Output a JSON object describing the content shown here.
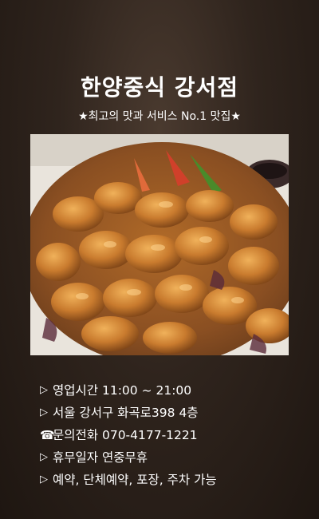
{
  "header": {
    "title": "한양중식 강서점",
    "subtitle": "★최고의 맛과 서비스 No.1 맛집★"
  },
  "photo": {
    "subject": "fried-pork-dish-photo"
  },
  "info": {
    "hours": {
      "marker": "▷",
      "text": "영업시간 11:00 ~ 21:00"
    },
    "address": {
      "marker": "▷",
      "text": "서울 강서구 화곡로398 4층"
    },
    "phone": {
      "marker": "☎",
      "text": "문의전화 070-4177-1221"
    },
    "holiday": {
      "marker": "▷",
      "text": "휴무일자 연중무휴"
    },
    "services": {
      "marker": "▷",
      "text": "예약, 단체예약, 포장, 주차 가능"
    }
  }
}
